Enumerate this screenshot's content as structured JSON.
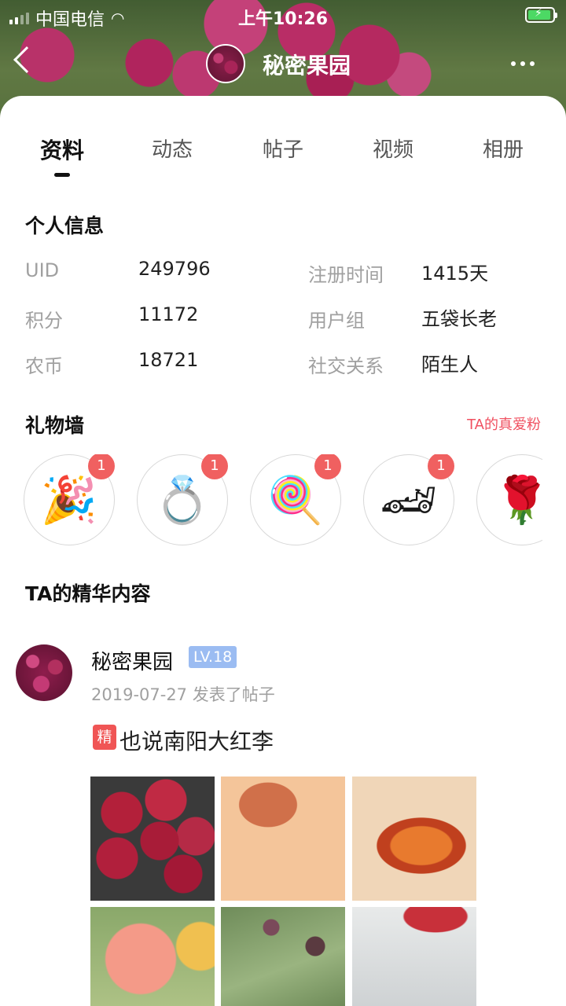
{
  "status_bar": {
    "carrier": "中国电信",
    "time": "上午10:26"
  },
  "nav": {
    "title": "秘密果园"
  },
  "tabs": [
    {
      "label": "资料",
      "active": true
    },
    {
      "label": "动态",
      "active": false
    },
    {
      "label": "帖子",
      "active": false
    },
    {
      "label": "视频",
      "active": false
    },
    {
      "label": "相册",
      "active": false
    }
  ],
  "personal_info": {
    "title": "个人信息",
    "fields": [
      {
        "label": "UID",
        "value": "249796"
      },
      {
        "label": "注册时间",
        "value": "1415天"
      },
      {
        "label": "积分",
        "value": "11172"
      },
      {
        "label": "用户组",
        "value": "五袋长老"
      },
      {
        "label": "农币",
        "value": "18721"
      },
      {
        "label": "社交关系",
        "value": "陌生人"
      }
    ]
  },
  "gift_wall": {
    "title": "礼物墙",
    "fans_link": "TA的真爱粉",
    "gifts": [
      {
        "icon": "party-popper-icon",
        "glyph": "🎉",
        "count": "1"
      },
      {
        "icon": "diamond-ring-icon",
        "glyph": "💍",
        "count": "1"
      },
      {
        "icon": "lollipop-icon",
        "glyph": "🍭",
        "count": "1"
      },
      {
        "icon": "sports-car-icon",
        "glyph": "🏎",
        "count": "1"
      },
      {
        "icon": "rose-icon",
        "glyph": "🌹",
        "count": ""
      }
    ]
  },
  "essence": {
    "title": "TA的精华内容",
    "post": {
      "author": "秘密果园",
      "level": "LV.18",
      "meta": "2019-07-27 发表了帖子",
      "badge": "精",
      "title": "也说南阳大红李"
    }
  },
  "colors": {
    "accent_red": "#f05060",
    "level_badge": "#9bbcf2",
    "badge_red": "#f06060"
  }
}
